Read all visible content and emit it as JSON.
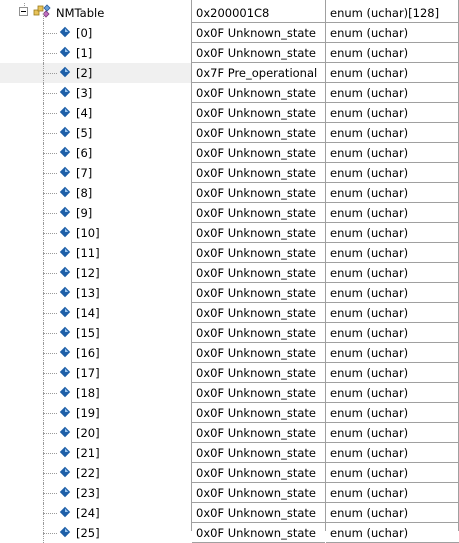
{
  "root": {
    "name": "NMTable",
    "value": "0x200001C8",
    "type": "enum (uchar)[128]"
  },
  "items": [
    {
      "index": "[0]",
      "value": "0x0F Unknown_state",
      "type": "enum (uchar)"
    },
    {
      "index": "[1]",
      "value": "0x0F Unknown_state",
      "type": "enum (uchar)"
    },
    {
      "index": "[2]",
      "value": "0x7F Pre_operational",
      "type": "enum (uchar)"
    },
    {
      "index": "[3]",
      "value": "0x0F Unknown_state",
      "type": "enum (uchar)"
    },
    {
      "index": "[4]",
      "value": "0x0F Unknown_state",
      "type": "enum (uchar)"
    },
    {
      "index": "[5]",
      "value": "0x0F Unknown_state",
      "type": "enum (uchar)"
    },
    {
      "index": "[6]",
      "value": "0x0F Unknown_state",
      "type": "enum (uchar)"
    },
    {
      "index": "[7]",
      "value": "0x0F Unknown_state",
      "type": "enum (uchar)"
    },
    {
      "index": "[8]",
      "value": "0x0F Unknown_state",
      "type": "enum (uchar)"
    },
    {
      "index": "[9]",
      "value": "0x0F Unknown_state",
      "type": "enum (uchar)"
    },
    {
      "index": "[10]",
      "value": "0x0F Unknown_state",
      "type": "enum (uchar)"
    },
    {
      "index": "[11]",
      "value": "0x0F Unknown_state",
      "type": "enum (uchar)"
    },
    {
      "index": "[12]",
      "value": "0x0F Unknown_state",
      "type": "enum (uchar)"
    },
    {
      "index": "[13]",
      "value": "0x0F Unknown_state",
      "type": "enum (uchar)"
    },
    {
      "index": "[14]",
      "value": "0x0F Unknown_state",
      "type": "enum (uchar)"
    },
    {
      "index": "[15]",
      "value": "0x0F Unknown_state",
      "type": "enum (uchar)"
    },
    {
      "index": "[16]",
      "value": "0x0F Unknown_state",
      "type": "enum (uchar)"
    },
    {
      "index": "[17]",
      "value": "0x0F Unknown_state",
      "type": "enum (uchar)"
    },
    {
      "index": "[18]",
      "value": "0x0F Unknown_state",
      "type": "enum (uchar)"
    },
    {
      "index": "[19]",
      "value": "0x0F Unknown_state",
      "type": "enum (uchar)"
    },
    {
      "index": "[20]",
      "value": "0x0F Unknown_state",
      "type": "enum (uchar)"
    },
    {
      "index": "[21]",
      "value": "0x0F Unknown_state",
      "type": "enum (uchar)"
    },
    {
      "index": "[22]",
      "value": "0x0F Unknown_state",
      "type": "enum (uchar)"
    },
    {
      "index": "[23]",
      "value": "0x0F Unknown_state",
      "type": "enum (uchar)"
    },
    {
      "index": "[24]",
      "value": "0x0F Unknown_state",
      "type": "enum (uchar)"
    },
    {
      "index": "[25]",
      "value": "0x0F Unknown_state",
      "type": "enum (uchar)"
    }
  ],
  "selected_index": 2,
  "colors": {
    "grid_line": "#a0a0a0",
    "selected_row": "#f0f0f0",
    "var_icon": "#1d5fa8"
  },
  "icons": {
    "root": "struct-array-icon",
    "item": "variable-diamond-icon",
    "expander": "collapse-minus-icon"
  }
}
